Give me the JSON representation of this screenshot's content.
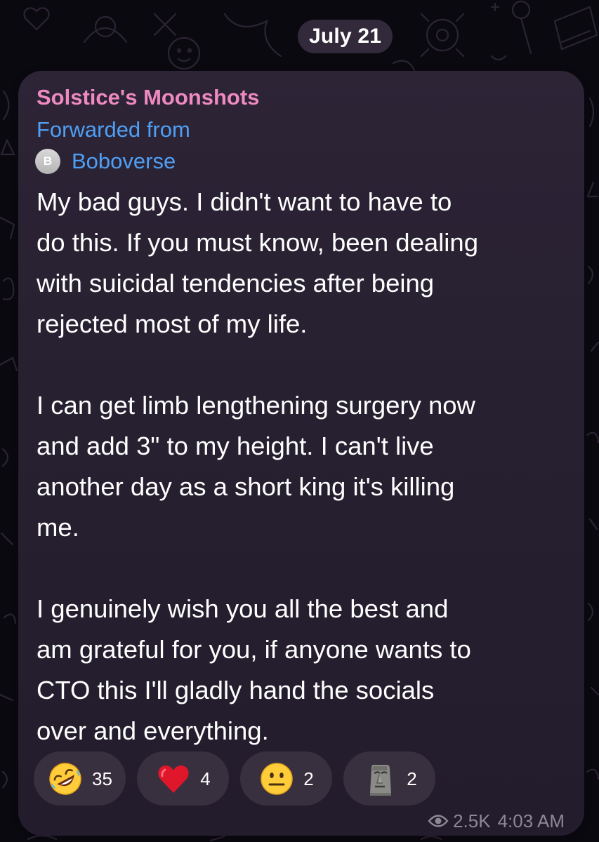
{
  "date_separator": "July 21",
  "message": {
    "channel_name": "Solstice's Moonshots",
    "forwarded_label": "Forwarded from",
    "forward_source": {
      "avatar_letter": "B",
      "name": "Boboverse"
    },
    "paragraphs": [
      [
        "My bad guys. I didn't want to have to",
        "do this. If you must know, been dealing",
        "with suicidal tendencies after being",
        "rejected most of my life."
      ],
      [
        "I can get limb lengthening surgery now",
        "and add 3\" to my height. I can't live",
        "another day as a short king it's killing",
        "me."
      ],
      [
        "I genuinely wish you all the best and",
        "am grateful for you, if anyone wants to",
        "CTO this I'll gladly hand the socials",
        "over and everything."
      ]
    ],
    "reactions": [
      {
        "icon": "rolling-on-floor-laughing-emoji",
        "count": "35"
      },
      {
        "icon": "red-heart-emoji",
        "count": "4"
      },
      {
        "icon": "neutral-face-emoji",
        "count": "2"
      },
      {
        "icon": "moai-emoji",
        "count": "2"
      }
    ],
    "views": "2.5K",
    "time": "4:03 AM"
  },
  "colors": {
    "channel_name": "#ef8ac0",
    "link_blue": "#4f9ff5",
    "bubble": "#2a2233",
    "reaction_pill": "#39303f",
    "meta_text": "#8e8796"
  }
}
